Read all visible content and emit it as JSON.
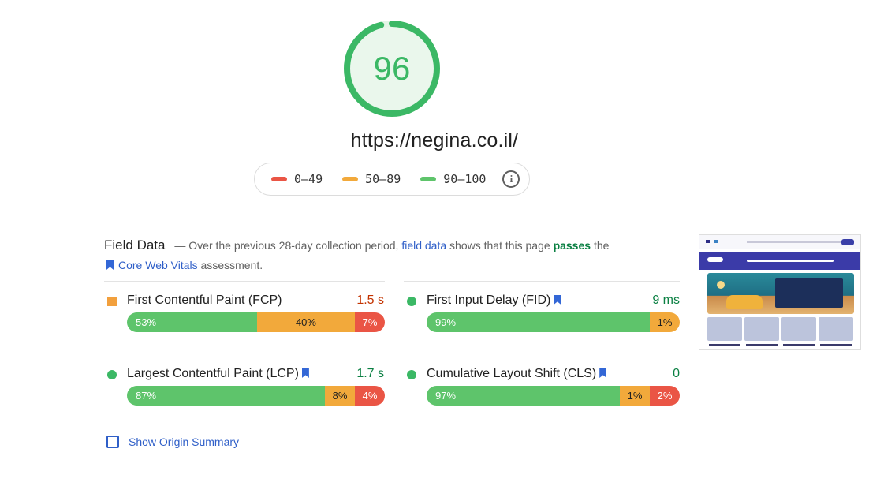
{
  "score": {
    "value": "96",
    "fraction": 0.96,
    "color": "#3bb865",
    "track_color": "#e3f5e6"
  },
  "url": "https://negina.co.il/",
  "legend": {
    "items": [
      {
        "label": "0–49",
        "color": "#ea5545"
      },
      {
        "label": "50–89",
        "color": "#f2a93b"
      },
      {
        "label": "90–100",
        "color": "#5ec46b"
      }
    ],
    "info_icon": "info-icon"
  },
  "field_data": {
    "title": "Field Data",
    "dash": "—",
    "text1": "Over the previous 28-day collection period,",
    "link_field_data": "field data",
    "text2": "shows that this page",
    "passes": "passes",
    "text3": "the",
    "link_cwv": "Core Web Vitals",
    "text4": "assessment."
  },
  "metrics": {
    "fcp": {
      "name": "First Contentful Paint (FCP)",
      "value": "1.5 s",
      "good": "53%",
      "avg": "40%",
      "poor": "7%",
      "good_pct": 53,
      "avg_pct": 40,
      "poor_pct": 7
    },
    "fid": {
      "name": "First Input Delay (FID)",
      "value": "9 ms",
      "good": "99%",
      "avg": "1%",
      "good_pct": 99,
      "avg_pct": 1,
      "poor_pct": 0
    },
    "lcp": {
      "name": "Largest Contentful Paint (LCP)",
      "value": "1.7 s",
      "good": "87%",
      "avg": "8%",
      "poor": "4%",
      "good_pct": 87,
      "avg_pct": 8,
      "poor_pct": 4
    },
    "cls": {
      "name": "Cumulative Layout Shift (CLS)",
      "value": "0",
      "good": "97%",
      "avg": "1%",
      "poor": "2%",
      "good_pct": 97,
      "avg_pct": 1,
      "poor_pct": 2
    }
  },
  "origin_summary": {
    "label": "Show Origin Summary",
    "checked": false
  },
  "colors": {
    "good": "#5ec46b",
    "average": "#f2a93b",
    "poor": "#ea5545",
    "link": "#2f5fc8",
    "pass": "#0b8043"
  }
}
